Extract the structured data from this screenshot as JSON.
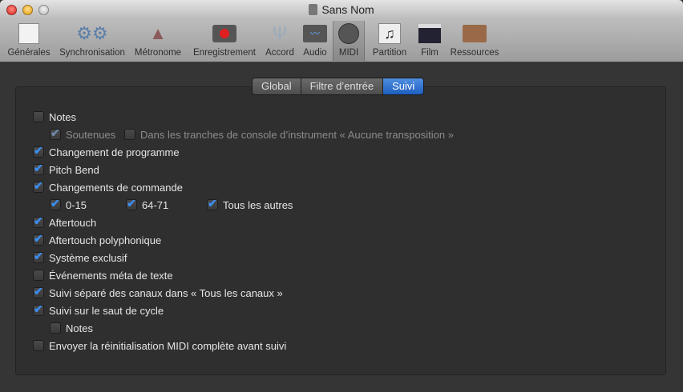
{
  "window": {
    "title": "Sans Nom"
  },
  "toolbar": [
    {
      "label": "Générales",
      "icon": "switch-icon"
    },
    {
      "label": "Synchronisation",
      "icon": "gears-icon"
    },
    {
      "label": "Métronome",
      "icon": "metronome-icon"
    },
    {
      "label": "Enregistrement",
      "icon": "record-icon"
    },
    {
      "label": "Accord",
      "icon": "tuning-fork-icon"
    },
    {
      "label": "Audio",
      "icon": "waveform-icon"
    },
    {
      "label": "MIDI",
      "icon": "midi-connector-icon",
      "selected": true
    },
    {
      "label": "Partition",
      "icon": "score-icon"
    },
    {
      "label": "Film",
      "icon": "clapperboard-icon"
    },
    {
      "label": "Ressources",
      "icon": "briefcase-icon"
    }
  ],
  "tabs": [
    {
      "label": "Global"
    },
    {
      "label": "Filtre d’entrée"
    },
    {
      "label": "Suivi",
      "selected": true
    }
  ],
  "options": [
    {
      "label": "Notes",
      "checked": false
    },
    {
      "label": "Soutenues",
      "checked": true,
      "disabled": true
    },
    {
      "label": "Dans les tranches de console d’instrument « Aucune transposition »",
      "checked": false,
      "disabled": true
    },
    {
      "label": "Changement de programme",
      "checked": true
    },
    {
      "label": "Pitch Bend",
      "checked": true
    },
    {
      "label": "Changements de commande",
      "checked": true
    },
    {
      "label": "0-15",
      "checked": true
    },
    {
      "label": "64-71",
      "checked": true
    },
    {
      "label": "Tous les autres",
      "checked": true
    },
    {
      "label": "Aftertouch",
      "checked": true
    },
    {
      "label": "Aftertouch polyphonique",
      "checked": true
    },
    {
      "label": "Système exclusif",
      "checked": true
    },
    {
      "label": "Événements méta de texte",
      "checked": false
    },
    {
      "label": "Suivi séparé des canaux dans « Tous les canaux »",
      "checked": true
    },
    {
      "label": "Suivi sur le saut de cycle",
      "checked": true
    },
    {
      "label": "Notes",
      "checked": false
    },
    {
      "label": "Envoyer la réinitialisation MIDI complète avant suivi",
      "checked": false
    }
  ]
}
